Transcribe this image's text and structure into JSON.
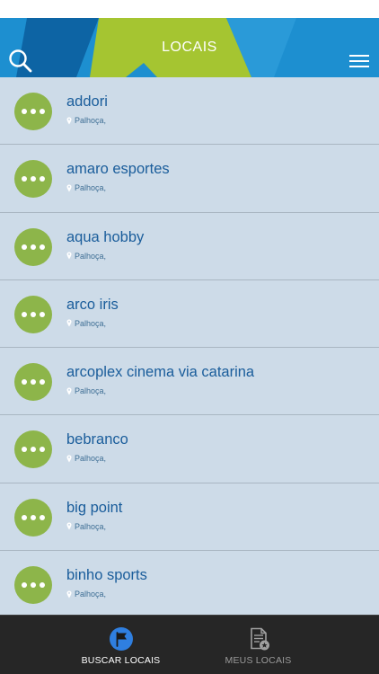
{
  "header": {
    "title": "LOCAIS",
    "search_icon": "search-icon",
    "menu_icon": "hamburger-menu-icon",
    "colors": {
      "blue": "#1d8fd0",
      "dark_blue": "#0d64a4",
      "green": "#a5c531"
    }
  },
  "places": [
    {
      "name": "addori",
      "city": "Palhoça,"
    },
    {
      "name": "amaro esportes",
      "city": "Palhoça,"
    },
    {
      "name": "aqua hobby",
      "city": "Palhoça,"
    },
    {
      "name": "arco iris",
      "city": "Palhoça,"
    },
    {
      "name": "arcoplex cinema via catarina",
      "city": "Palhoça,"
    },
    {
      "name": "bebranco",
      "city": "Palhoça,"
    },
    {
      "name": "big point",
      "city": "Palhoça,"
    },
    {
      "name": "binho sports",
      "city": "Palhoça,"
    }
  ],
  "list_colors": {
    "background": "#cddbe8",
    "name_text": "#1a5d9b",
    "more_button": "#8db54a"
  },
  "tabs": [
    {
      "label": "BUSCAR LOCAIS",
      "icon": "flag-icon",
      "active": true
    },
    {
      "label": "MEUS LOCAIS",
      "icon": "document-star-icon",
      "active": false
    }
  ]
}
